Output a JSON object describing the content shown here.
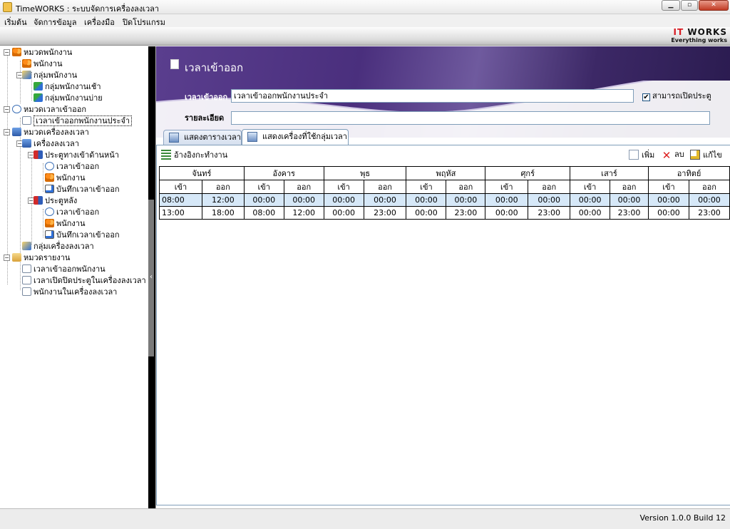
{
  "window": {
    "title": "TimeWORKS : ระบบจัดการเครื่องลงเวลา",
    "min_glyph": "▁",
    "max_glyph": "▫",
    "close_glyph": "✕"
  },
  "menu": [
    "เริ่มต้น",
    "จัดการข้อมูล",
    "เครื่องมือ",
    "ปิดโปรแกรม"
  ],
  "logo": {
    "brand_red": "IT",
    "brand_dark": " WORKS",
    "tagline": "Everything works"
  },
  "tree": [
    {
      "label": "หมวดพนักงาน",
      "icon": "people-icon",
      "expander": "⊟"
    },
    {
      "label": "พนักงาน",
      "icon": "people-icon"
    },
    {
      "label": "กลุ่มพนักงาน",
      "icon": "group-icon",
      "expander": "⊟"
    },
    {
      "label": "กลุ่มพนักงานเช้า",
      "icon": "user-group-icon"
    },
    {
      "label": "กลุ่มพนักงานบ่าย",
      "icon": "user-group-icon"
    },
    {
      "label": "หมวดเวลาเข้าออก",
      "icon": "clock-icon",
      "expander": "⊟"
    },
    {
      "label": "เวลาเข้าออกพนักงานประจำ",
      "icon": "document-icon"
    },
    {
      "label": "หมวดเครื่องลงเวลา",
      "icon": "machine-icon",
      "expander": "⊟"
    },
    {
      "label": "เครื่องลงเวลา",
      "icon": "machine-icon",
      "expander": "⊟"
    },
    {
      "label": "ประตูทางเข้าด้านหน้า",
      "icon": "door-icon",
      "expander": "⊟"
    },
    {
      "label": "เวลาเข้าออก",
      "icon": "clock-icon"
    },
    {
      "label": "พนักงาน",
      "icon": "people-icon"
    },
    {
      "label": "บันทึกเวลาเข้าออก",
      "icon": "note-icon"
    },
    {
      "label": "ประตูหลัง",
      "icon": "door-icon",
      "expander": "⊟"
    },
    {
      "label": "เวลาเข้าออก",
      "icon": "clock-icon"
    },
    {
      "label": "พนักงาน",
      "icon": "people-icon"
    },
    {
      "label": "บันทึกเวลาเข้าออก",
      "icon": "note-icon"
    },
    {
      "label": "กลุ่มเครื่องลงเวลา",
      "icon": "group-icon"
    },
    {
      "label": "หมวดรายงาน",
      "icon": "folder-icon",
      "expander": "⊟"
    },
    {
      "label": "เวลาเข้าออกพนักงาน",
      "icon": "report-icon"
    },
    {
      "label": "เวลาเปิดปิดประตูในเครื่องลงเวลา",
      "icon": "report-icon"
    },
    {
      "label": "พนักงานในเครื่องลงเวลา",
      "icon": "report-icon"
    }
  ],
  "splitter_arrow": "‹",
  "page": {
    "title": "เวลาเข้าออก",
    "time_label": "เวลาเข้าออก",
    "time_value": "เวลาเข้าออกพนักงานประจำ",
    "detail_label": "รายละเอียด",
    "detail_value": "",
    "can_open_door_label": "สามารถเปิดประตู",
    "can_open_door_checked": true,
    "check_glyph": "✔"
  },
  "tabs": [
    {
      "label": "แสดงตารางเวลา",
      "active": false
    },
    {
      "label": "แสดงเครื่องที่ใช้กลุ่มเวลา",
      "active": true
    }
  ],
  "toolbar": {
    "reference_label": "อ้างอิงกะทำงาน",
    "add_label": "เพิ่ม",
    "delete_label": "ลบ",
    "delete_glyph": "✕",
    "edit_label": "แก้ไข"
  },
  "schedule": {
    "days": [
      "จันทร์",
      "อังคาร",
      "พุธ",
      "พฤหัส",
      "ศุกร์",
      "เสาร์",
      "อาทิตย์"
    ],
    "in_label": "เข้า",
    "out_label": "ออก",
    "rows": [
      [
        "08:00",
        "12:00",
        "00:00",
        "00:00",
        "00:00",
        "00:00",
        "00:00",
        "00:00",
        "00:00",
        "00:00",
        "00:00",
        "00:00",
        "00:00",
        "00:00"
      ],
      [
        "13:00",
        "18:00",
        "08:00",
        "12:00",
        "00:00",
        "23:00",
        "00:00",
        "23:00",
        "00:00",
        "23:00",
        "00:00",
        "23:00",
        "00:00",
        "23:00"
      ]
    ],
    "selected_row": 0
  },
  "status": {
    "version": "Version 1.0.0 Build 12"
  }
}
